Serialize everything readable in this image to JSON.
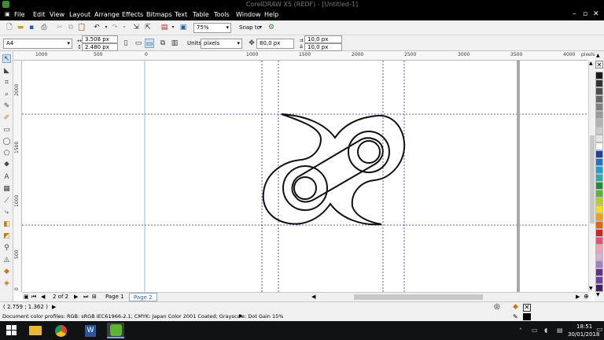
{
  "window": {
    "title": "CorelDRAW X5 (REDF) - [Untitled-1]",
    "controls": [
      "–",
      "▫",
      "✕"
    ]
  },
  "menu": [
    "File",
    "Edit",
    "View",
    "Layout",
    "Arrange",
    "Effects",
    "Bitmaps",
    "Text",
    "Table",
    "Tools",
    "Window",
    "Help"
  ],
  "standard_toolbar": {
    "zoom": "75%",
    "snap_to": "Snap to"
  },
  "property_bar": {
    "page_size": "A4",
    "width": "3.508 px",
    "height": "2.480 px",
    "units_label": "Units:",
    "units": "pixels",
    "nudge": "80,0 px",
    "dup_x": "10,0 px",
    "dup_y": "10,0 px"
  },
  "ruler": {
    "h_labels": [
      "1000",
      "500",
      "0",
      "1000",
      "1500",
      "2000",
      "2500",
      "3000",
      "3500",
      "4000"
    ],
    "unit": "pixels",
    "v_labels": [
      "2000",
      "1500",
      "1000",
      "500",
      "0"
    ]
  },
  "page_nav": {
    "counter": "2 of 2",
    "tabs": [
      "Page 1",
      "Page 2"
    ],
    "active": 1
  },
  "status": {
    "coords": "( 2.759 ; 1.362 )",
    "color_profiles": "Document color profiles: RGB: sRGB IEC61966-2.1; CMYK: Japan Color 2001 Coated; Grayscale: Dot Gain 15%"
  },
  "taskbar": {
    "time": "18:51",
    "date": "30/01/2018"
  },
  "colors": {
    "accent": "#1f5fb8",
    "guide": "#2a2a9a",
    "palette": [
      "#1a1a1a",
      "#333333",
      "#4d4d4d",
      "#666666",
      "#808080",
      "#999999",
      "#b3b3b3",
      "#cccccc",
      "#e6e6e6",
      "#ffffff",
      "#1e3f9e",
      "#2570c8",
      "#18a0d8",
      "#2ab0a0",
      "#1e8c3a",
      "#5ab530",
      "#b8d020",
      "#f5e010",
      "#f0a010",
      "#e86010",
      "#d82020",
      "#e85070",
      "#f0a0b0",
      "#d8b0d0",
      "#a080c0",
      "#603090",
      "#7040a0",
      "#402060"
    ]
  }
}
